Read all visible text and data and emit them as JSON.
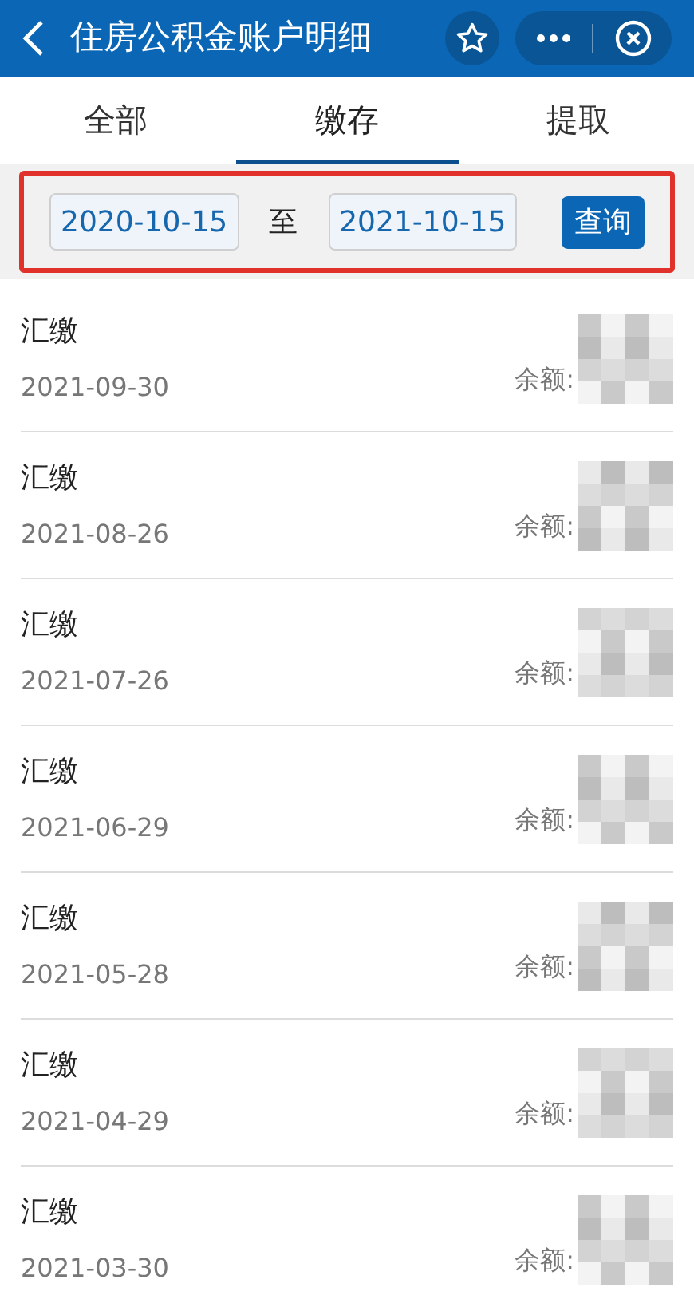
{
  "header": {
    "title": "住房公积金账户明细"
  },
  "tabs": [
    {
      "label": "全部",
      "selected": false
    },
    {
      "label": "缴存",
      "selected": true
    },
    {
      "label": "提取",
      "selected": false
    }
  ],
  "filter": {
    "start_date": "2020-10-15",
    "separator": "至",
    "end_date": "2021-10-15",
    "button": "查询"
  },
  "records": [
    {
      "type": "汇缴",
      "date": "2021-09-30",
      "balance_label": "余额:"
    },
    {
      "type": "汇缴",
      "date": "2021-08-26",
      "balance_label": "余额:"
    },
    {
      "type": "汇缴",
      "date": "2021-07-26",
      "balance_label": "余额:"
    },
    {
      "type": "汇缴",
      "date": "2021-06-29",
      "balance_label": "余额:"
    },
    {
      "type": "汇缴",
      "date": "2021-05-28",
      "balance_label": "余额:"
    },
    {
      "type": "汇缴",
      "date": "2021-04-29",
      "balance_label": "余额:"
    },
    {
      "type": "汇缴",
      "date": "2021-03-30",
      "balance_label": "余额:"
    }
  ]
}
